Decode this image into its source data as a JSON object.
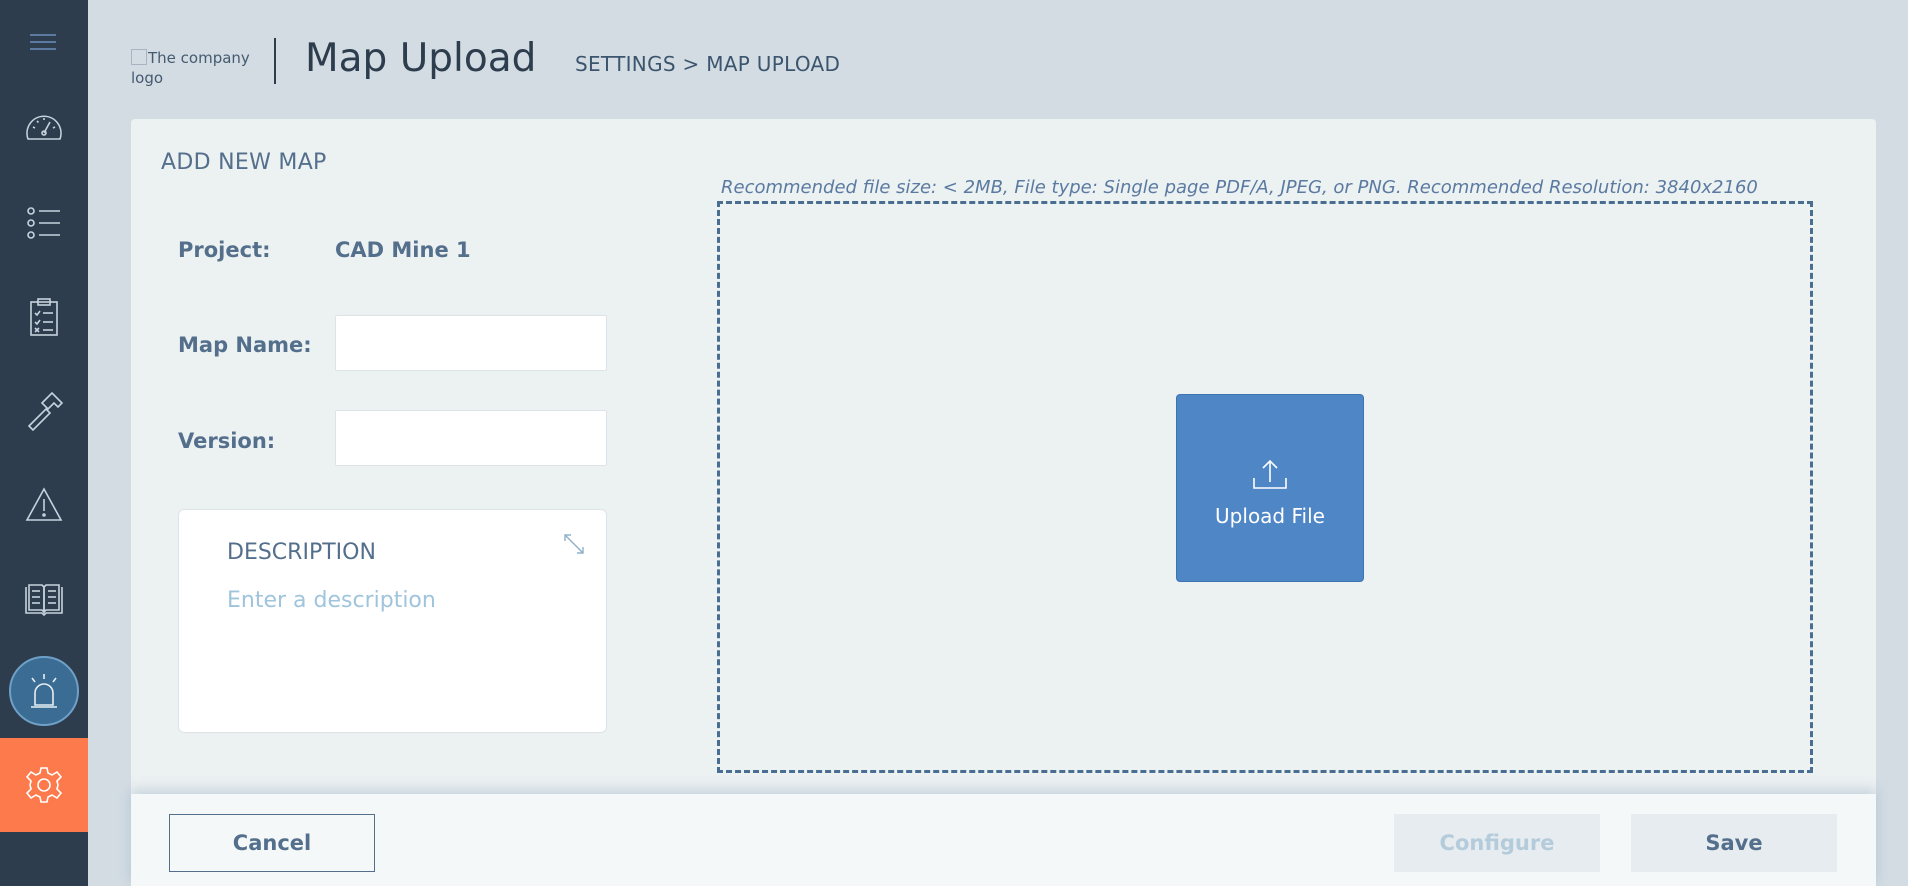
{
  "sidebar": {
    "items": [
      {
        "name": "dashboard",
        "icon": "speedometer-icon"
      },
      {
        "name": "list",
        "icon": "list-icon"
      },
      {
        "name": "checklist",
        "icon": "clipboard-checklist-icon"
      },
      {
        "name": "tools",
        "icon": "hammer-icon"
      },
      {
        "name": "warnings",
        "icon": "warning-icon"
      },
      {
        "name": "manual",
        "icon": "book-icon"
      },
      {
        "name": "alarms",
        "icon": "alarm-light-icon"
      },
      {
        "name": "settings",
        "icon": "gear-icon"
      }
    ],
    "active_color": "#fd7a4c"
  },
  "header": {
    "logo_alt": "The company logo",
    "title": "Map Upload",
    "breadcrumb": "SETTINGS > MAP UPLOAD"
  },
  "form": {
    "section_title": "ADD NEW MAP",
    "project_label": "Project:",
    "project_value": "CAD Mine 1",
    "map_name_label": "Map Name:",
    "map_name_value": "",
    "version_label": "Version:",
    "version_value": "",
    "description_label": "DESCRIPTION",
    "description_placeholder": "Enter a description"
  },
  "upload": {
    "hint": "Recommended file size: < 2MB, File type: Single page PDF/A, JPEG, or PNG. Recommended Resolution: 3840x2160",
    "button_label": "Upload File"
  },
  "footer": {
    "cancel_label": "Cancel",
    "configure_label": "Configure",
    "save_label": "Save"
  },
  "colors": {
    "sidebar_bg": "#2e3d4d",
    "accent_blue": "#4f86c6",
    "text": "#546f8c"
  }
}
